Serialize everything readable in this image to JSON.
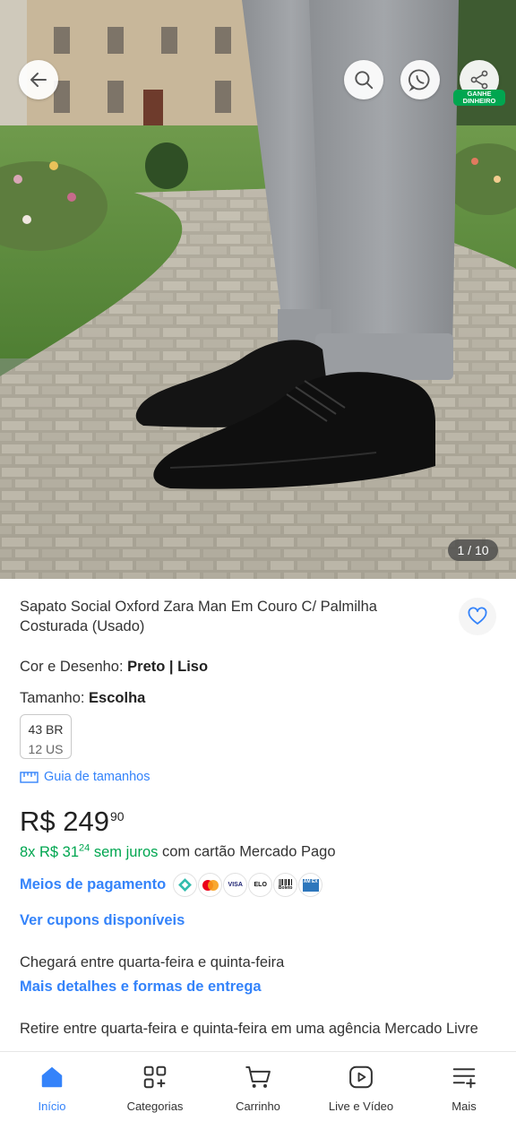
{
  "gallery": {
    "counter": "1 / 10",
    "earn_badge_line1": "GANHE",
    "earn_badge_line2": "DINHEIRO"
  },
  "product": {
    "title": "Sapato Social Oxford Zara Man Em Couro C/ Palmilha Costurada (Usado)",
    "color_label": "Cor e Desenho: ",
    "color_value": "Preto | Liso",
    "size_label": "Tamanho: ",
    "size_value": "Escolha",
    "size_option_br": "43 BR",
    "size_option_us": "12 US",
    "size_guide_link": "Guia de tamanhos",
    "price_main": "R$ 249",
    "price_cents": "90",
    "installments_prefix": "8x R$ 31",
    "installments_cents": "24",
    "installments_interest": " sem juros",
    "installments_suffix": " com cartão Mercado Pago",
    "payment_methods_link": "Meios de pagamento",
    "payment_icons": [
      "pix-icon",
      "mastercard-icon",
      "visa-icon",
      "elo-icon",
      "boleto-icon",
      "amex-icon"
    ],
    "payment_icon_labels": {
      "visa": "VISA",
      "elo": "ELO",
      "boleto": "Boleto",
      "amex": "AM EX"
    },
    "coupons_link": "Ver cupons disponíveis",
    "arrival_text": "Chegará entre quarta-feira e quinta-feira",
    "delivery_link": "Mais detalhes e formas de entrega",
    "pickup_text": "Retire entre quarta-feira e quinta-feira em uma agência Mercado Livre"
  },
  "nav": {
    "items": [
      {
        "label": "Início",
        "icon": "home-icon",
        "active": true
      },
      {
        "label": "Categorias",
        "icon": "categories-icon",
        "active": false
      },
      {
        "label": "Carrinho",
        "icon": "cart-icon",
        "active": false
      },
      {
        "label": "Live e Vídeo",
        "icon": "play-icon",
        "active": false
      },
      {
        "label": "Mais",
        "icon": "menu-plus-icon",
        "active": false
      }
    ]
  },
  "colors": {
    "accent_blue": "#3483fa",
    "green": "#00a650",
    "text": "#333333"
  }
}
